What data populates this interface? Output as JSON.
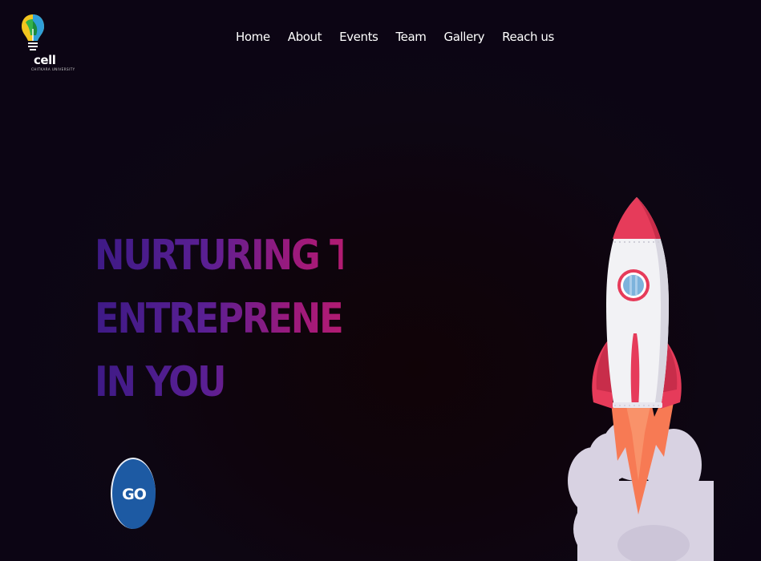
{
  "brand": {
    "logo_text": "cell",
    "logo_subtitle": "CHITKARA UNIVERSITY"
  },
  "nav": {
    "items": [
      {
        "label": "Home"
      },
      {
        "label": "About"
      },
      {
        "label": "Events"
      },
      {
        "label": "Team"
      },
      {
        "label": "Gallery"
      },
      {
        "label": "Reach us"
      }
    ]
  },
  "hero": {
    "lines": [
      "NURTURING THE",
      "ENTREPRENEUR",
      "IN YOU"
    ]
  },
  "cta": {
    "label": "GO"
  },
  "colors": {
    "background": "#0c0512",
    "headline_start": "#3e1a86",
    "headline_end": "#b21b72",
    "button": "#1d5aa3",
    "rocket_red": "#e63b5a",
    "rocket_body": "#f2f2f5",
    "flame": "#f77a54",
    "smoke": "#d8d2e2"
  },
  "icons": {
    "logo": "lightbulb-logo-icon",
    "rocket": "rocket-illustration"
  }
}
